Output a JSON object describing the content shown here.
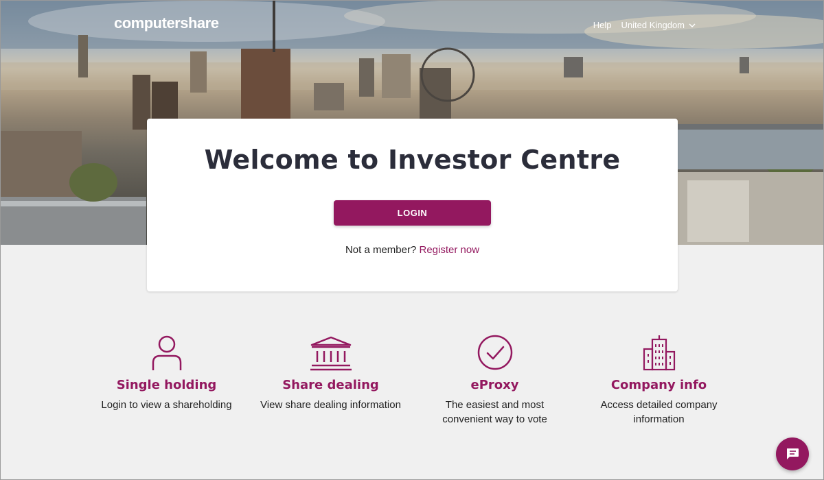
{
  "header": {
    "logo_text": "computershare",
    "help_label": "Help",
    "country_label": "United Kingdom"
  },
  "login_card": {
    "title": "Welcome to Investor Centre",
    "login_label": "LOGIN",
    "not_member_text": "Not a member?",
    "register_label": "Register now"
  },
  "features": [
    {
      "icon": "person-icon",
      "title": "Single holding",
      "description": "Login to view a shareholding"
    },
    {
      "icon": "bank-building-icon",
      "title": "Share dealing",
      "description": "View share dealing information"
    },
    {
      "icon": "check-circle-icon",
      "title": "eProxy",
      "description": "The easiest and most convenient way to vote"
    },
    {
      "icon": "office-buildings-icon",
      "title": "Company info",
      "description": "Access detailed company information"
    }
  ],
  "colors": {
    "brand": "#93185f",
    "title_text": "#2b2d3a",
    "page_background": "#f0f0f0"
  }
}
